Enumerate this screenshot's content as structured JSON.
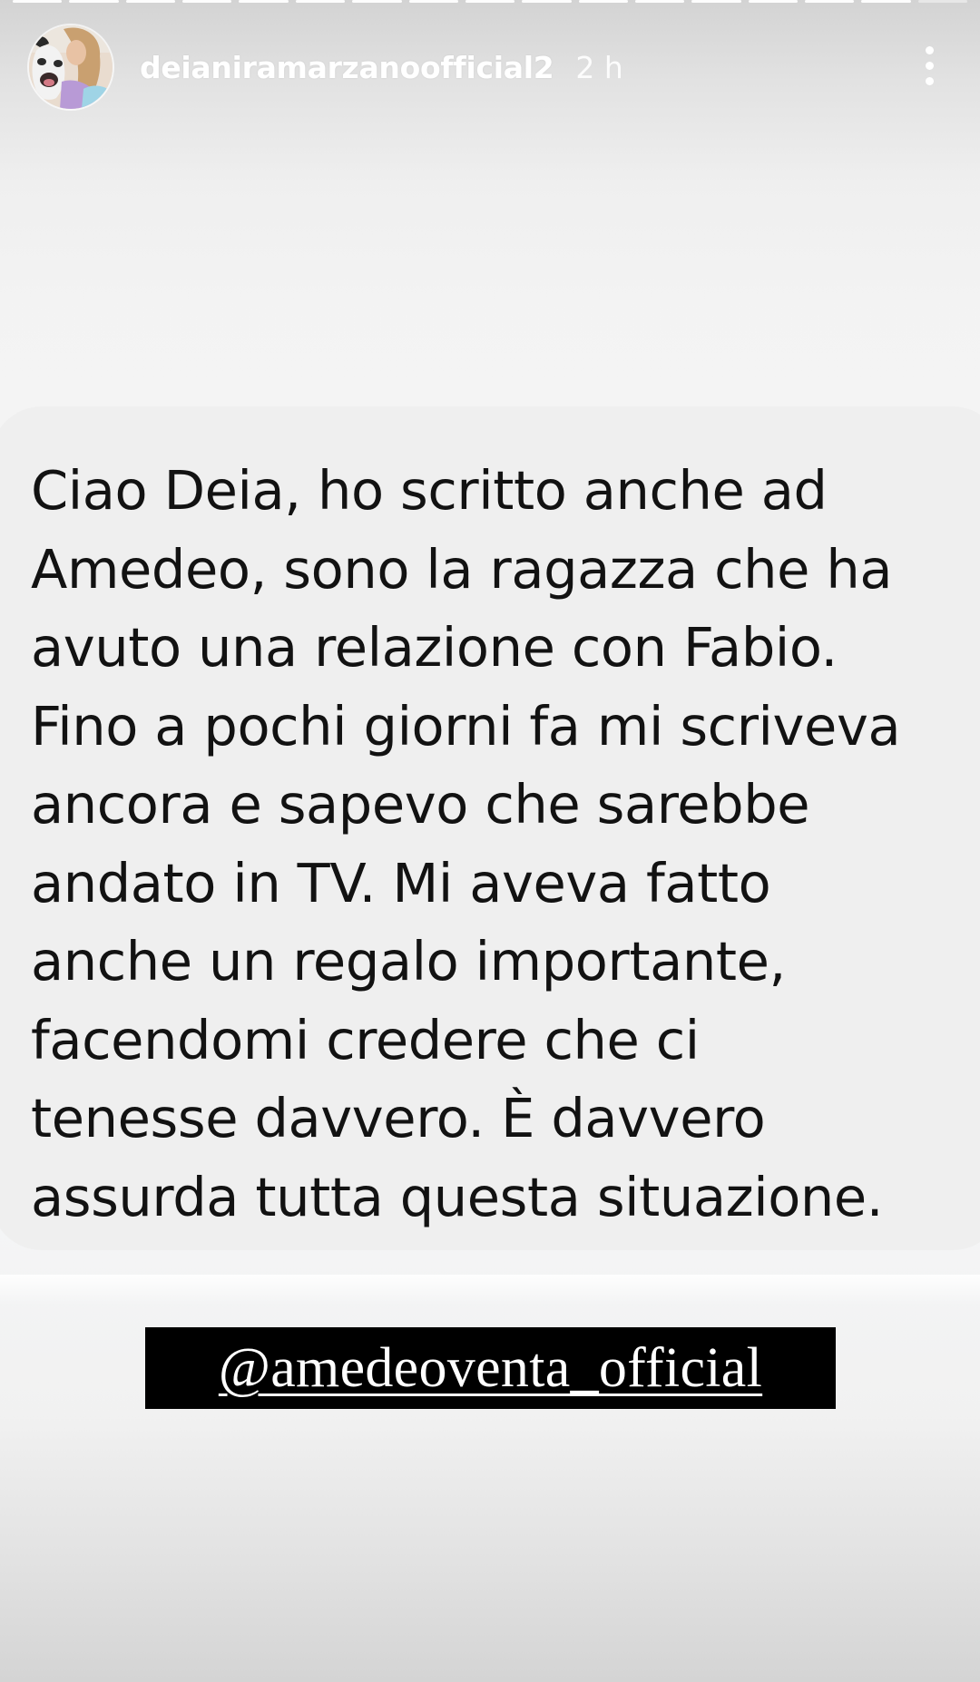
{
  "story": {
    "segments_total": 17,
    "segments_viewed": 16
  },
  "header": {
    "username": "deianiramarzanoofficial2",
    "timestamp": "2 h",
    "more_icon": "more-vertical-icon",
    "avatar_icon": "avatar-photo"
  },
  "message": {
    "lines": [
      "Ciao Deia, ho scritto anche ad",
      "Amedeo, sono la ragazza che ha",
      "avuto una relazione con Fabio.",
      "Fino a pochi giorni fa mi scriveva",
      "ancora e sapevo che sarebbe",
      "andato in TV. Mi aveva fatto",
      "anche un regalo importante,",
      "facendomi credere che ci",
      "tenesse davvero. È davvero",
      "assurda tutta questa situazione."
    ]
  },
  "mention": {
    "text": "@amedeoventa_official"
  },
  "colors": {
    "bubble": "#efefef",
    "text": "#121212",
    "sticker_bg": "#000000",
    "sticker_text": "#ffffff"
  }
}
